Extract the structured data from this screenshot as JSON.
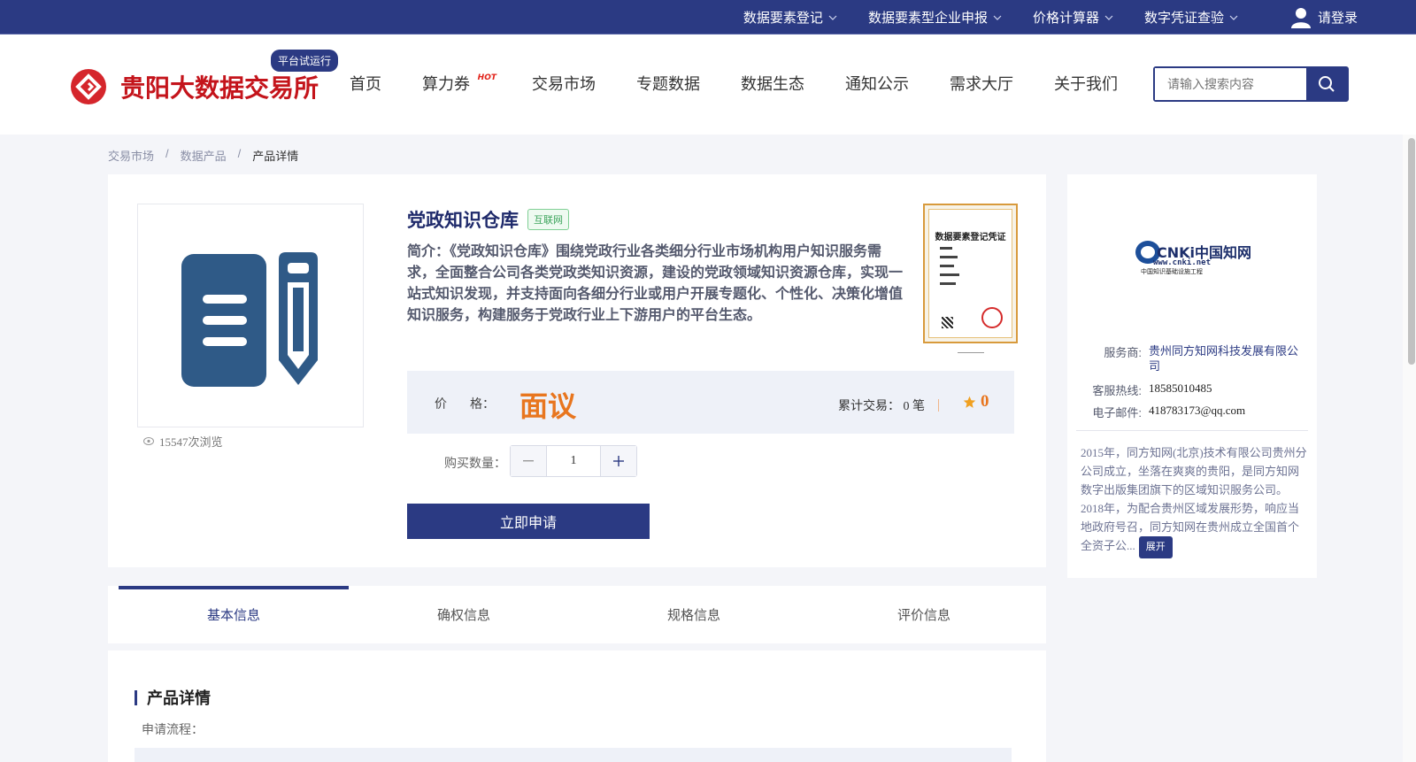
{
  "topbar": {
    "links": [
      "数据要素登记",
      "数据要素型企业申报",
      "价格计算器",
      "数字凭证查验"
    ],
    "login": "请登录"
  },
  "header": {
    "site_name": "贵阳大数据交易所",
    "trial_badge": "平台试运行",
    "nav": [
      "首页",
      "算力券",
      "交易市场",
      "专题数据",
      "数据生态",
      "通知公示",
      "需求大厅",
      "关于我们"
    ],
    "hot_label": "HOT",
    "search_placeholder": "请输入搜索内容"
  },
  "breadcrumb": [
    "交易市场",
    "数据产品",
    "产品详情"
  ],
  "product": {
    "title": "党政知识仓库",
    "tag": "互联网",
    "description": "简介：《党政知识仓库》围绕党政行业各类细分行业市场机构用户知识服务需求，全面整合公司各类党政类知识资源，建设的党政领域知识资源仓库，实现一站式知识发现，并支持面向各细分行业或用户开展专题化、个性化、决策化增值知识服务，构建服务于党政行业上下游用户的平台生态。",
    "views": "15547次浏览",
    "certificate_title": "数据要素登记凭证",
    "price_label_1": "价",
    "price_label_2": "格：",
    "price": "面议",
    "trade_count": "累计交易：  0 笔",
    "rating": "0",
    "qty_label": "购买数量：",
    "qty_value": "1",
    "apply_button": "立即申请"
  },
  "provider": {
    "logo_text_main": "CNKi中国知网",
    "logo_text_url": "www.cnki.net",
    "logo_text_sub": "中国知识基础设施工程",
    "service_label": "服务商:",
    "service_value": "贵州同方知网科技发展有限公司",
    "hotline_label": "客服热线:",
    "hotline_value": "18585010485",
    "email_label": "电子邮件:",
    "email_value": "418783173@qq.com",
    "description": "2015年，同方知网(北京)技术有限公司贵州分公司成立，坐落在爽爽的贵阳，是同方知网数字出版集团旗下的区域知识服务公司。 2018年，为配合贵州区域发展形势，响应当地政府号召，同方知网在贵州成立全国首个全资子公...",
    "expand": "展开"
  },
  "tabs": [
    "基本信息",
    "确权信息",
    "规格信息",
    "评价信息"
  ],
  "detail": {
    "section_title": "产品详情",
    "apply_process": "申请流程："
  },
  "colors": {
    "primary": "#2b3a83",
    "accent_orange": "#e8761f",
    "logo_red": "#c4141b"
  }
}
